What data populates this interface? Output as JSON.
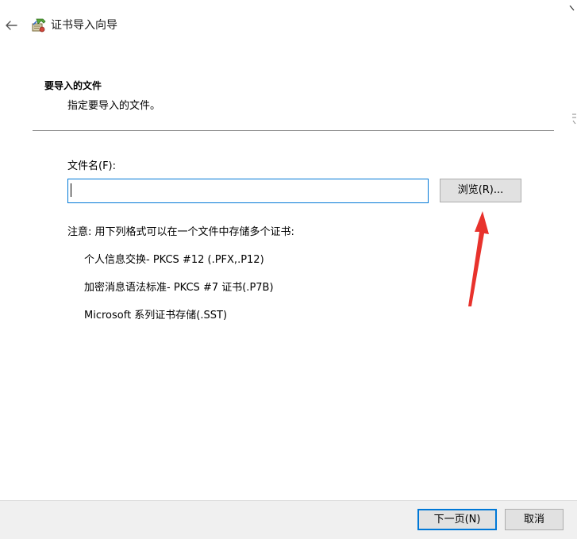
{
  "window": {
    "title": "证书导入向导"
  },
  "page": {
    "heading": "要导入的文件",
    "subheading": "指定要导入的文件。"
  },
  "form": {
    "filename_label": "文件名(F):",
    "filename_value": "",
    "browse_label": "浏览(R)..."
  },
  "note": {
    "text": "注意: 用下列格式可以在一个文件中存储多个证书:",
    "formats": [
      "个人信息交换- PKCS #12 (.PFX,.P12)",
      "加密消息语法标准- PKCS #7 证书(.P7B)",
      "Microsoft 系列证书存储(.SST)"
    ]
  },
  "footer": {
    "next_label": "下一页(N)",
    "cancel_label": "取消"
  },
  "colors": {
    "accent_blue": "#0078d7",
    "annotation_red": "#e8322c",
    "button_face": "#e1e1e1",
    "footer_bg": "#f0f0f0"
  },
  "icons": {
    "back": "back-arrow-icon",
    "wizard": "certificate-wizard-icon"
  }
}
